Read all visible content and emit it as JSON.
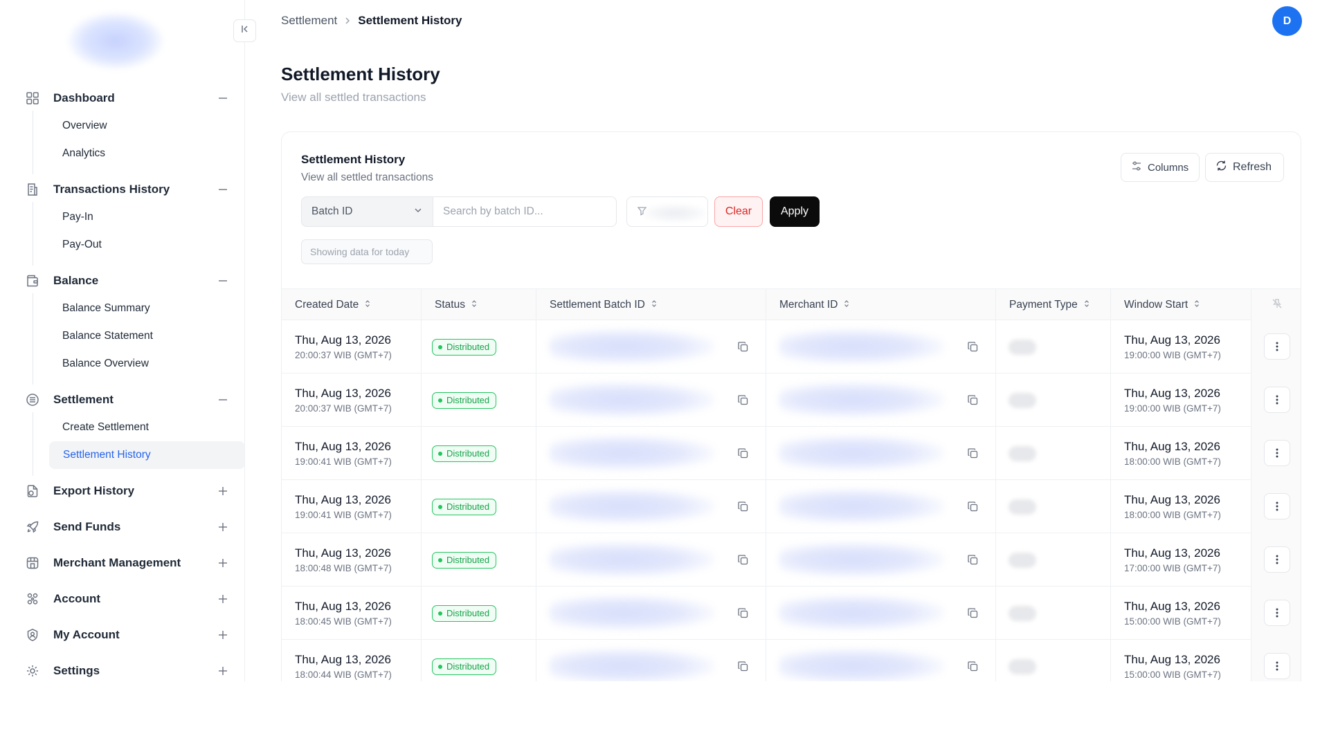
{
  "breadcrumb": {
    "parent": "Settlement",
    "current": "Settlement History"
  },
  "user": {
    "avatar_initial": "D"
  },
  "page": {
    "title": "Settlement History",
    "subtitle": "View all settled transactions"
  },
  "sidebar": {
    "groups": [
      {
        "label": "Dashboard",
        "icon": "grid-icon",
        "expanded": true,
        "children": [
          "Overview",
          "Analytics"
        ]
      },
      {
        "label": "Transactions History",
        "icon": "receipt-icon",
        "expanded": true,
        "children": [
          "Pay-In",
          "Pay-Out"
        ]
      },
      {
        "label": "Balance",
        "icon": "wallet-icon",
        "expanded": true,
        "children": [
          "Balance Summary",
          "Balance Statement",
          "Balance Overview"
        ]
      },
      {
        "label": "Settlement",
        "icon": "list-icon",
        "expanded": true,
        "children": [
          "Create Settlement",
          "Settlement History"
        ],
        "active_child": "Settlement History"
      },
      {
        "label": "Export History",
        "icon": "export-icon",
        "expanded": false
      },
      {
        "label": "Send Funds",
        "icon": "rocket-icon",
        "expanded": false
      },
      {
        "label": "Merchant Management",
        "icon": "store-icon",
        "expanded": false
      },
      {
        "label": "Account",
        "icon": "users-icon",
        "expanded": false
      },
      {
        "label": "My Account",
        "icon": "user-shield-icon",
        "expanded": false
      },
      {
        "label": "Settings",
        "icon": "gear-icon",
        "expanded": false
      }
    ]
  },
  "card": {
    "title": "Settlement History",
    "subtitle": "View all settled transactions",
    "columns_label": "Columns",
    "refresh_label": "Refresh",
    "filter": {
      "field_selected": "Batch ID",
      "search_placeholder": "Search by batch ID...",
      "clear_label": "Clear",
      "apply_label": "Apply",
      "today_label": "Showing data for today"
    }
  },
  "table": {
    "headers": [
      "Created Date",
      "Status",
      "Settlement Batch ID",
      "Merchant ID",
      "Payment Type",
      "Window Start"
    ],
    "rows": [
      {
        "created_date": "Thu, Aug 13, 2026",
        "created_time": "20:00:37 WIB (GMT+7)",
        "status": "Distributed",
        "window_date": "Thu, Aug 13, 2026",
        "window_time": "19:00:00 WIB (GMT+7)"
      },
      {
        "created_date": "Thu, Aug 13, 2026",
        "created_time": "20:00:37 WIB (GMT+7)",
        "status": "Distributed",
        "window_date": "Thu, Aug 13, 2026",
        "window_time": "19:00:00 WIB (GMT+7)"
      },
      {
        "created_date": "Thu, Aug 13, 2026",
        "created_time": "19:00:41 WIB (GMT+7)",
        "status": "Distributed",
        "window_date": "Thu, Aug 13, 2026",
        "window_time": "18:00:00 WIB (GMT+7)"
      },
      {
        "created_date": "Thu, Aug 13, 2026",
        "created_time": "19:00:41 WIB (GMT+7)",
        "status": "Distributed",
        "window_date": "Thu, Aug 13, 2026",
        "window_time": "18:00:00 WIB (GMT+7)"
      },
      {
        "created_date": "Thu, Aug 13, 2026",
        "created_time": "18:00:48 WIB (GMT+7)",
        "status": "Distributed",
        "window_date": "Thu, Aug 13, 2026",
        "window_time": "17:00:00 WIB (GMT+7)"
      },
      {
        "created_date": "Thu, Aug 13, 2026",
        "created_time": "18:00:45 WIB (GMT+7)",
        "status": "Distributed",
        "window_date": "Thu, Aug 13, 2026",
        "window_time": "15:00:00 WIB (GMT+7)"
      },
      {
        "created_date": "Thu, Aug 13, 2026",
        "created_time": "18:00:44 WIB (GMT+7)",
        "status": "Distributed",
        "window_date": "Thu, Aug 13, 2026",
        "window_time": "15:00:00 WIB (GMT+7)"
      }
    ]
  },
  "colors": {
    "accent": "#2563eb",
    "avatar": "#1d72f2",
    "success": "#16a34a",
    "danger": "#dc2626",
    "apply_bg": "#0b0b0b"
  }
}
